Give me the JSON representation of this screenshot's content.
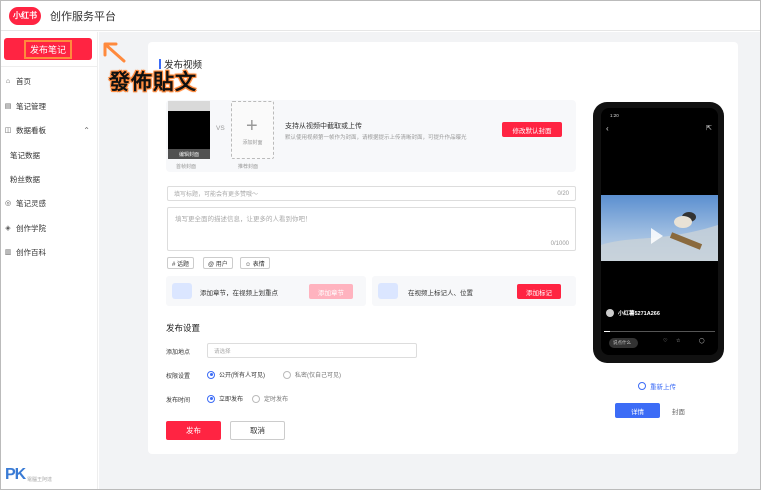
{
  "header": {
    "logo": "小红书",
    "title": "创作服务平台"
  },
  "sidebar": {
    "publish_label": "发布笔记",
    "items": [
      {
        "icon": "home-icon",
        "glyph": "⌂",
        "label": "首页"
      },
      {
        "icon": "note-icon",
        "glyph": "▤",
        "label": "笔记管理"
      },
      {
        "icon": "chart-icon",
        "glyph": "◫",
        "label": "数据看板",
        "expanded": true
      },
      {
        "label": "笔记数据",
        "sub": true
      },
      {
        "label": "粉丝数据",
        "sub": true
      },
      {
        "icon": "bulb-icon",
        "glyph": "◎",
        "label": "笔记灵感"
      },
      {
        "icon": "school-icon",
        "glyph": "◈",
        "label": "创作学院"
      },
      {
        "icon": "book-icon",
        "glyph": "▥",
        "label": "创作百科"
      }
    ]
  },
  "annotation": {
    "text": "發佈貼文",
    "arrow_color": "#ff8a3d"
  },
  "form": {
    "section_title": "发布视频",
    "cover": {
      "thumb_label": "编辑封面",
      "thumb_caption": "首帧封面",
      "vs": "VS",
      "add_label": "添加封面",
      "add_caption": "推荐封面",
      "hint_title": "支持从视频中截取或上传",
      "hint_desc": "默认使用视频第一帧作为封面，请根据提示上传清晰封面，可提升作品曝光",
      "edit_button": "修改默认封面"
    },
    "title_placeholder": "填写标题，可能会有更多赞哦～",
    "title_count": "0/20",
    "desc_placeholder": "填写更全面的描述信息，让更多的人看到你吧！",
    "desc_count": "0/1000",
    "chips": [
      "# 话题",
      "@ 用户",
      "☺ 表情"
    ],
    "features": [
      {
        "text": "添加章节，在视频上划重点",
        "button": "添加章节",
        "button_color": "#ffb3bf"
      },
      {
        "text": "在视频上标记人、位置",
        "button": "添加标记",
        "button_color": "#ff2442"
      }
    ],
    "settings_title": "发布设置",
    "location": {
      "label": "添加地点",
      "placeholder": "请选择"
    },
    "visibility": {
      "label": "权限设置",
      "options": [
        "公开(所有人可见)",
        "私密(仅自己可见)"
      ]
    },
    "schedule": {
      "label": "发布时间",
      "options": [
        "立即发布",
        "定时发布"
      ]
    },
    "submit": "发布",
    "cancel": "取消"
  },
  "phone": {
    "time": "1:20",
    "username": "小红薯5271A266",
    "comment_placeholder": "说点什么",
    "stats": [
      "赞",
      "收藏",
      "评论"
    ],
    "progress": 0.05
  },
  "preview": {
    "reupload": "重新上传",
    "tab_detail": "详情",
    "tab_cover": "封面"
  },
  "watermark": {
    "brand": "PK",
    "sub": "電腦王阿達"
  }
}
